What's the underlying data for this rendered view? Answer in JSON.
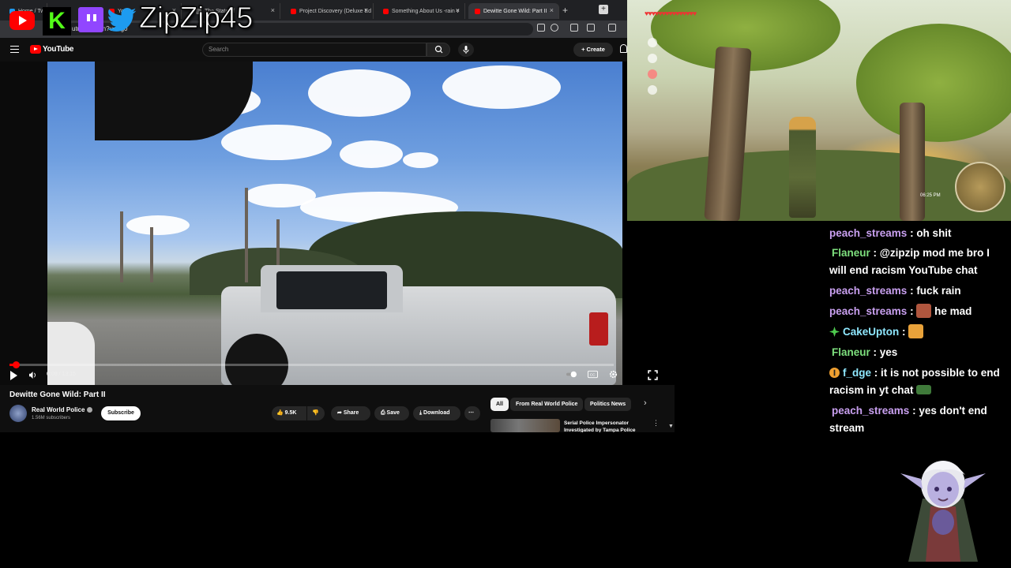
{
  "browser": {
    "tabs": [
      {
        "label": "Home / Tw",
        "active": false
      },
      {
        "label": "YouTu",
        "active": false
      },
      {
        "label": "The State of",
        "active": false
      },
      {
        "label": "Project Discovery (Deluxe Ed",
        "active": false
      },
      {
        "label": "Something About Us -rain v",
        "active": false
      },
      {
        "label": "Dewitte Gone Wild: Part II",
        "active": true
      }
    ],
    "url": "utu       m/watch?v=Pg0",
    "colors": {
      "tab_bg": "#202124",
      "active_tab": "#35363a"
    }
  },
  "overlay": {
    "handle": "ZipZip45",
    "icons": [
      "youtube-logo-icon",
      "kick-logo-icon",
      "twitch-logo-icon",
      "twitter-bird-icon"
    ]
  },
  "youtube": {
    "logo_text": "YouTube",
    "search_placeholder": "Search",
    "create_label": "Create",
    "video": {
      "title": "Dewitte Gone Wild: Part II",
      "time": "0:08 / 13:15",
      "progress_fraction": 0.01
    },
    "channel": {
      "name": "Real World Police",
      "subscribers": "1.56M subscribers",
      "subscribe_label": "Subscribe"
    },
    "actions": {
      "likes": "9.5K",
      "share": "Share",
      "save": "Save",
      "download": "Download",
      "more": "⋯"
    },
    "chips": [
      {
        "label": "All",
        "active": true
      },
      {
        "label": "From Real World Police",
        "active": false
      },
      {
        "label": "Politics News",
        "active": false
      }
    ],
    "related": {
      "title": "Serial Police Impersonator Investigated by Tampa Police"
    },
    "colors": {
      "bg": "#0f0f0f",
      "accent": "#ff0000"
    }
  },
  "game": {
    "hearts": "♥♥♥♥♥♥♥♥♥♥♥♥♥♥♥",
    "clock": "06:25 PM"
  },
  "chat": {
    "messages": [
      {
        "user": "peach_streams",
        "text": "oh shit",
        "color": "#c9a0f0",
        "badge": "",
        "emote": ""
      },
      {
        "user": "Flaneur",
        "text": "@zipzip mod me bro I will end racism YouTube chat",
        "color": "#7ee07e",
        "badge": "",
        "emote": ""
      },
      {
        "user": "peach_streams",
        "text": "fuck rain",
        "color": "#c9a0f0",
        "badge": "",
        "emote": ""
      },
      {
        "user": "peach_streams",
        "text": "he mad",
        "color": "#c9a0f0",
        "badge": "",
        "emote": "face-emote"
      },
      {
        "user": "CakeUpton",
        "text": "",
        "color": "#8fe8ff",
        "badge": "green-sparkle-badge",
        "emote": "fire-emote"
      },
      {
        "user": "Flaneur",
        "text": "yes",
        "color": "#7ee07e",
        "badge": "",
        "emote": ""
      },
      {
        "user": "f_dge",
        "text": "it is not possible to end racism in yt chat",
        "color": "#8fe8ff",
        "badge": "orange-info-badge",
        "emote": "frog-emote"
      },
      {
        "user": "peach_streams",
        "text": "yes don't end stream",
        "color": "#c9a0f0",
        "badge": "",
        "emote": ""
      }
    ]
  }
}
